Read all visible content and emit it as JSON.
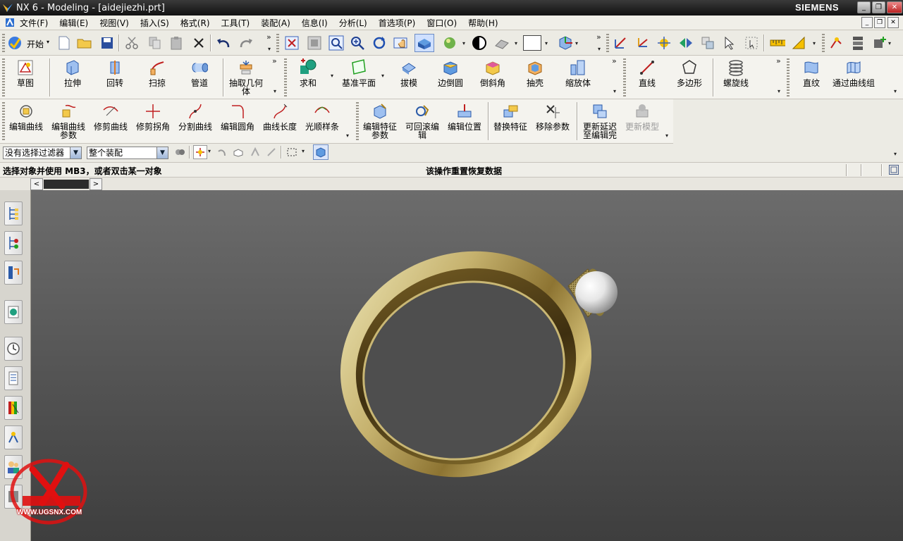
{
  "window": {
    "title": "NX 6 - Modeling - [aidejiezhi.prt]",
    "brand": "SIEMENS",
    "controls": {
      "minimize": "_",
      "restore": "❐",
      "close": "✕"
    }
  },
  "menu": {
    "items": [
      "文件(F)",
      "编辑(E)",
      "视图(V)",
      "插入(S)",
      "格式(R)",
      "工具(T)",
      "装配(A)",
      "信息(I)",
      "分析(L)",
      "首选项(P)",
      "窗口(O)",
      "帮助(H)"
    ]
  },
  "toolbar_standard": {
    "start_label": "开始",
    "overflow": "»"
  },
  "toolbar_features": {
    "buttons": [
      "草图",
      "拉伸",
      "回转",
      "扫掠",
      "管道",
      "抽取几何体",
      "求和",
      "基准平面",
      "拔模",
      "边倒圆",
      "倒斜角",
      "抽壳",
      "缩放体",
      "直线",
      "多边形",
      "螺旋线",
      "直纹",
      "通过曲线组"
    ]
  },
  "toolbar_edit": {
    "buttons": [
      "编辑曲线",
      "编辑曲线参数",
      "修剪曲线",
      "修剪拐角",
      "分割曲线",
      "编辑圆角",
      "曲线长度",
      "光顺样条",
      "编辑特征参数",
      "可回滚编辑",
      "编辑位置",
      "替换特征",
      "移除参数",
      "更新延迟至编辑完",
      "更新模型"
    ]
  },
  "selection_bar": {
    "filter_value": "没有选择过滤器",
    "scope_value": "整个装配"
  },
  "status": {
    "prompt": "选择对象并使用 MB3，或者双击某一对象",
    "message": "该操作重置恢复数据"
  },
  "navigator": {
    "left_arrow": "<",
    "right_arrow": ">"
  },
  "watermark": {
    "url": "WWW.UGSNX.COM"
  },
  "colors": {
    "titlebar": "#1f1f1f",
    "viewport_top": "#6c6c6c",
    "viewport_bottom": "#3e3e3e",
    "ring_gold": "#d8c98a",
    "pearl": "#f2f2f2"
  }
}
